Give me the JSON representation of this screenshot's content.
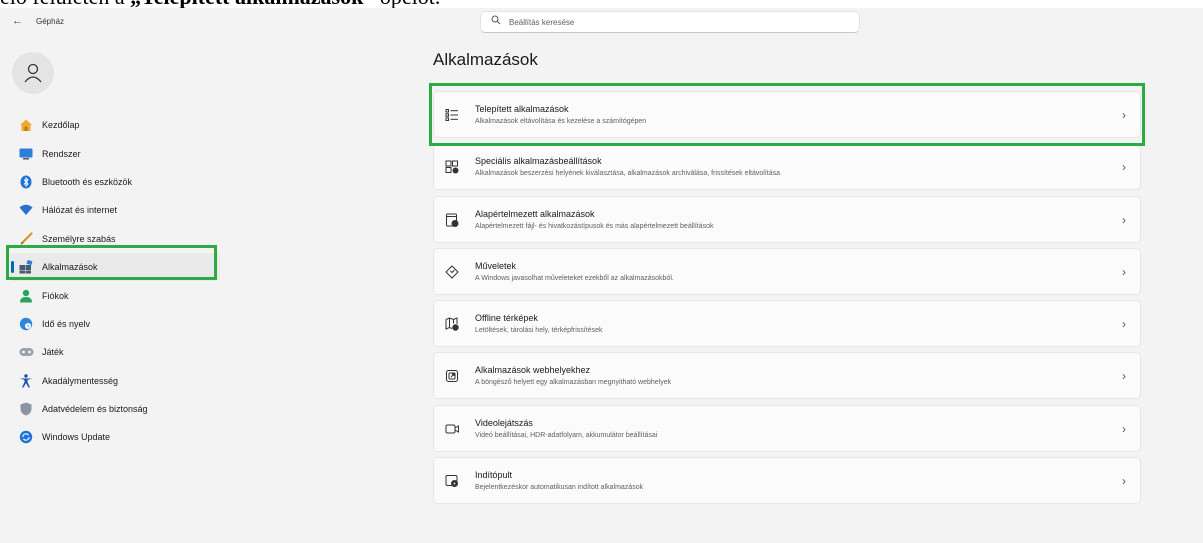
{
  "caption": {
    "prefix": "elő felületen a ",
    "bold": "„Telepített alkalmazások”",
    "suffix": " opciót."
  },
  "titlebar": {
    "back_label": "←",
    "app_title": "Gépház"
  },
  "search": {
    "placeholder": "Beállítás keresése"
  },
  "nav": {
    "items": [
      {
        "label": "Kezdőlap",
        "icon": "home-icon"
      },
      {
        "label": "Rendszer",
        "icon": "display-icon"
      },
      {
        "label": "Bluetooth és eszközök",
        "icon": "bluetooth-icon"
      },
      {
        "label": "Hálózat és internet",
        "icon": "wifi-icon"
      },
      {
        "label": "Személyre szabás",
        "icon": "brush-icon"
      },
      {
        "label": "Alkalmazások",
        "icon": "apps-icon",
        "selected": true
      },
      {
        "label": "Fiókok",
        "icon": "person-icon"
      },
      {
        "label": "Idő és nyelv",
        "icon": "globe-clock-icon"
      },
      {
        "label": "Játék",
        "icon": "gamepad-icon"
      },
      {
        "label": "Akadálymentesség",
        "icon": "accessibility-icon"
      },
      {
        "label": "Adatvédelem és biztonság",
        "icon": "shield-icon"
      },
      {
        "label": "Windows Update",
        "icon": "update-icon"
      }
    ]
  },
  "page": {
    "title": "Alkalmazások"
  },
  "cards": [
    {
      "title": "Telepített alkalmazások",
      "desc": "Alkalmazások eltávolítása és kezelése a számítógépen",
      "icon": "installed-apps-icon"
    },
    {
      "title": "Speciális alkalmazásbeállítások",
      "desc": "Alkalmazások beszerzési helyének kiválasztása, alkalmazások archiválása, frissítések eltávolítása",
      "icon": "advanced-apps-icon"
    },
    {
      "title": "Alapértelmezett alkalmazások",
      "desc": "Alapértelmezett fájl- és hivatkozástípusok és más alapértelmezett beállítások",
      "icon": "default-apps-icon"
    },
    {
      "title": "Műveletek",
      "desc": "A Windows javasolhat műveleteket ezekből az alkalmazásokból.",
      "icon": "actions-icon"
    },
    {
      "title": "Offline térképek",
      "desc": "Letöltések, tárolási hely, térképfrissítések",
      "icon": "offline-maps-icon"
    },
    {
      "title": "Alkalmazások webhelyekhez",
      "desc": "A böngésző helyett egy alkalmazásban megnyitható webhelyek",
      "icon": "apps-websites-icon"
    },
    {
      "title": "Videolejátszás",
      "desc": "Videó beállításai, HDR-adatfolyam, akkumulátor beállításai",
      "icon": "video-icon"
    },
    {
      "title": "Indítópult",
      "desc": "Bejelentkezéskor automatikusan indított alkalmazások",
      "icon": "startup-icon"
    }
  ],
  "colors": {
    "highlight": "#2eaa42",
    "accent": "#0067c0"
  }
}
